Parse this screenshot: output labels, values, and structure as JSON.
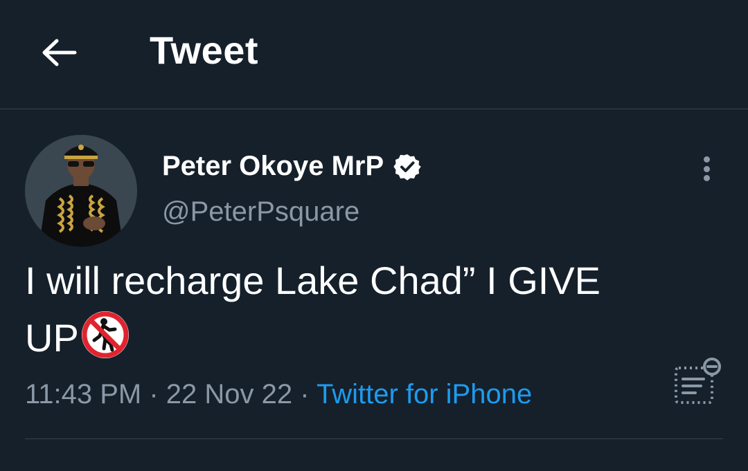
{
  "header": {
    "title": "Tweet",
    "back_icon": "arrow-left-icon"
  },
  "tweet": {
    "author": {
      "display_name": "Peter Okoye MrP",
      "handle": "@PeterPsquare",
      "verified": true
    },
    "text_line1": "I will recharge Lake Chad” I GIVE",
    "text_line2": "UP",
    "emoji": "no-pedestrians-emoji",
    "time": "11:43 PM",
    "sep1": " · ",
    "date": "22 Nov 22",
    "sep2": " · ",
    "source": "Twitter for iPhone"
  },
  "colors": {
    "background": "#15202b",
    "secondary_text": "#8b98a5",
    "link": "#1d9bf0",
    "divider": "#38444d"
  }
}
